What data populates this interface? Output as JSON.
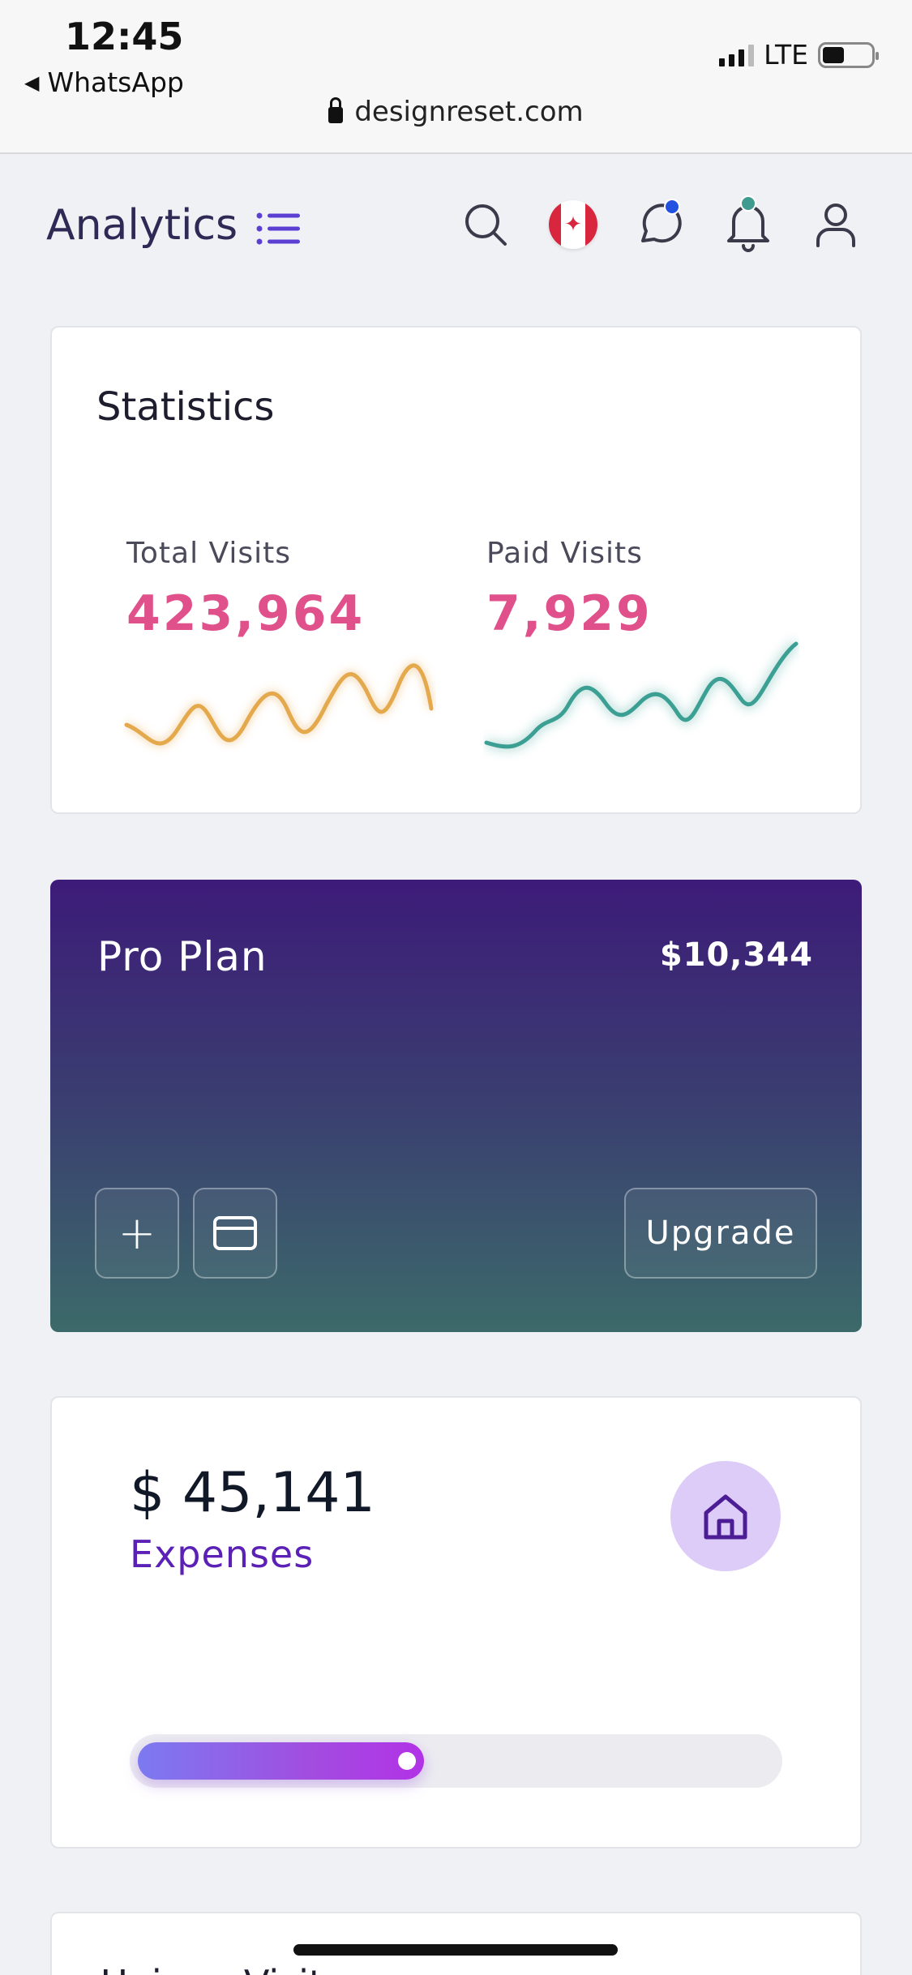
{
  "status_bar": {
    "time": "12:45",
    "back_app": "WhatsApp",
    "network": "LTE",
    "url": "designreset.com"
  },
  "header": {
    "title": "Analytics",
    "icons": [
      "menu-list-icon",
      "search-icon",
      "canada-flag-icon",
      "chat-icon",
      "bell-icon",
      "user-icon"
    ],
    "indicator_colors": {
      "chat": "#2452e0",
      "bell": "#3f9a8f"
    }
  },
  "statistics": {
    "title": "Statistics",
    "total_visits": {
      "label": "Total Visits",
      "value": "423,964",
      "color": "#e5a94d"
    },
    "paid_visits": {
      "label": "Paid Visits",
      "value": "7,929",
      "color": "#3c9f93"
    }
  },
  "pro_plan": {
    "title": "Pro Plan",
    "amount": "$10,344",
    "add_label": "+",
    "upgrade_label": "Upgrade"
  },
  "expenses": {
    "amount": "$ 45,141",
    "label": "Expenses",
    "progress": 0.45
  },
  "next_card": {
    "title": "Unique Visitors"
  }
}
